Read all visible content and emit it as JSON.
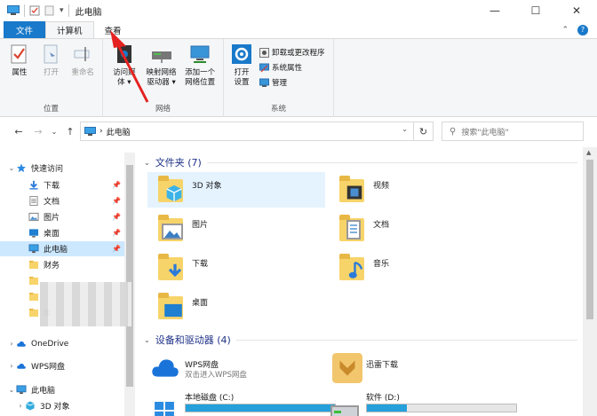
{
  "window": {
    "title": "此电脑",
    "qat_dropdown": "▾",
    "minimize": "—",
    "maximize": "☐",
    "close": "✕"
  },
  "tabs": [
    {
      "label": "文件"
    },
    {
      "label": "计算机"
    },
    {
      "label": "查看"
    }
  ],
  "tabs_right": {
    "collapse": "⌃",
    "help": "?"
  },
  "ribbon": {
    "groups": [
      {
        "label": "位置",
        "buttons": [
          "属性",
          "打开",
          "重命名"
        ]
      },
      {
        "label": "网络",
        "buttons": [
          "访问媒体",
          "映射网络驱动器",
          "添加一个网络位置"
        ]
      },
      {
        "label": "系统",
        "big_button": "打开设置",
        "small_buttons": [
          "卸载或更改程序",
          "系统属性",
          "管理"
        ]
      }
    ],
    "media_l1": "访问媒",
    "media_l2": "体",
    "map_l1": "映射网络",
    "map_l2": "驱动器",
    "add_l1": "添加一个",
    "add_l2": "网络位置",
    "settings_l1": "打开",
    "settings_l2": "设置",
    "dropdown_mark": "▾"
  },
  "address": {
    "path": "此电脑",
    "separator": "›",
    "search_placeholder": "搜索\"此电脑\"",
    "back": "←",
    "forward": "→",
    "recent": "⌄",
    "up": "↑",
    "refresh": "↻",
    "dropdown": "⌄",
    "search_icon": "⚲"
  },
  "nav": {
    "quick_access": "快速访问",
    "items": [
      "下载",
      "文档",
      "图片",
      "桌面",
      "此电脑",
      "财务"
    ],
    "partial_item": "年",
    "onedrive": "OneDrive",
    "wps": "WPS网盘",
    "this_pc": "此电脑",
    "objects3d": "3D 对象",
    "pin": "📌",
    "expand": "›",
    "expanded": "⌄"
  },
  "content": {
    "folders_header": "文件夹 (7)",
    "folders": [
      "3D 对象",
      "视频",
      "图片",
      "文档",
      "下载",
      "音乐",
      "桌面"
    ],
    "devices_header": "设备和驱动器 (4)",
    "wps_drive": {
      "name": "WPS网盘",
      "sub": "双击进入WPS网盘"
    },
    "thunder": {
      "name": "迅雷下载"
    },
    "drive_c": {
      "name": "本地磁盘 (C:)",
      "used_pct": 100
    },
    "drive_d": {
      "name": "软件 (D:)",
      "used_pct": 27
    },
    "collapse": "⌄"
  },
  "colors": {
    "accent": "#1979ca",
    "selection": "#cce8ff",
    "arrow": "#e52222"
  }
}
